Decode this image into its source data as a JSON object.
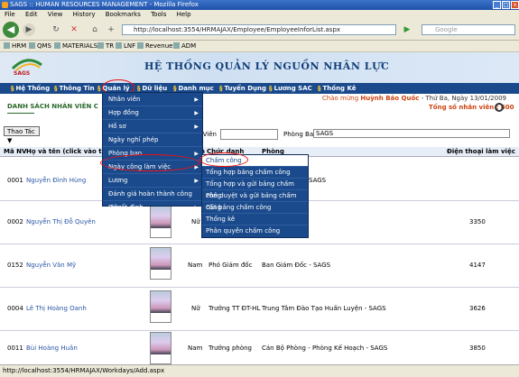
{
  "window": {
    "title": "SAGS :: HUMAN RESOURCES MANAGEMENT - Mozilla Firefox"
  },
  "menu": [
    "File",
    "Edit",
    "View",
    "History",
    "Bookmarks",
    "Tools",
    "Help"
  ],
  "address": {
    "url": "http://localhost:3554/HRMAJAX/Employee/EmployeeInforList.aspx",
    "search_placeholder": "Google"
  },
  "bookmarks": [
    "HRM",
    "QMS",
    "MATERIALS",
    "TR",
    "LNF",
    "Revenue",
    "ADM"
  ],
  "banner": {
    "logo_text": "SAGS",
    "title": "HỆ THỐNG QUẢN LÝ NGUỒN NHÂN LỰC"
  },
  "mainnav": [
    "Hệ Thống",
    "Thông Tin",
    "Quản lý",
    "Dữ liệu",
    "Danh mục",
    "Tuyển Dụng",
    "Lương SAC",
    "Thống Kê"
  ],
  "greeting": {
    "prefix": "Chào mừng ",
    "user": "Huỳnh Bảo Quốc",
    "date": " - Thứ Ba, Ngày 13/01/2009"
  },
  "page": {
    "heading": "DANH SÁCH NHÂN VIÊN C",
    "total_label": "Tổng số nhân viên : 600",
    "action_label": "Thao Tác ▼",
    "employee_label": "n Viên",
    "department_label": "Phòng Ban",
    "department_value": "SAGS"
  },
  "table": {
    "headers": [
      "Mã NV",
      "Họ và tên (click vào tên để",
      "h",
      "Chức danh",
      "Phòng",
      "Điện thoại làm việc"
    ],
    "rows": [
      {
        "id": "0001",
        "name": "Nguyễn Đình Hùng",
        "gender": "",
        "title": "",
        "dept": "SAGS",
        "phone": ""
      },
      {
        "id": "0002",
        "name": "Nguyễn Thị Đỗ Quyên",
        "gender": "Nữ",
        "title": "",
        "dept": "",
        "phone": "3350"
      },
      {
        "id": "0152",
        "name": "Nguyễn Văn Mỹ",
        "gender": "Nam",
        "title": "Phó Giám đốc",
        "dept": "Ban Giám Đốc - SAGS",
        "phone": "4147"
      },
      {
        "id": "0004",
        "name": "Lê Thị Hoàng Oanh",
        "gender": "Nữ",
        "title": "Trưởng TT ĐT-HL",
        "dept": "Trung Tâm Đào Tạo Huấn Luyện - SAGS",
        "phone": "3626"
      },
      {
        "id": "0011",
        "name": "Bùi Hoàng Huân",
        "gender": "Nam",
        "title": "Trưởng phòng",
        "dept": "Cán Bộ Phòng - Phòng Kế Hoạch - SAGS",
        "phone": "3850"
      }
    ]
  },
  "submenu_quanly": [
    "Nhân viên",
    "Hợp đồng",
    "Hồ sơ",
    "Ngày nghỉ phép",
    "Phòng ban",
    "Ngày công làm việc",
    "Lương",
    "Đánh giá hoàn thành công việc",
    "Quyết định"
  ],
  "submenu_ngaycong": [
    "Chấm công",
    "Tổng hợp bảng chấm công",
    "Tổng hợp và gửi bảng chấm công",
    "Phê duyệt và gửi bảng chấm công",
    "Gửi bảng chấm công",
    "Thống kê",
    "Phân quyền chấm công"
  ],
  "status": "http://localhost:3554/HRMAJAX/Workdays/Add.aspx",
  "colors": {
    "nav_blue": "#1a4a8c",
    "accent_red": "#e11",
    "heading_green": "#2b6a2b"
  }
}
